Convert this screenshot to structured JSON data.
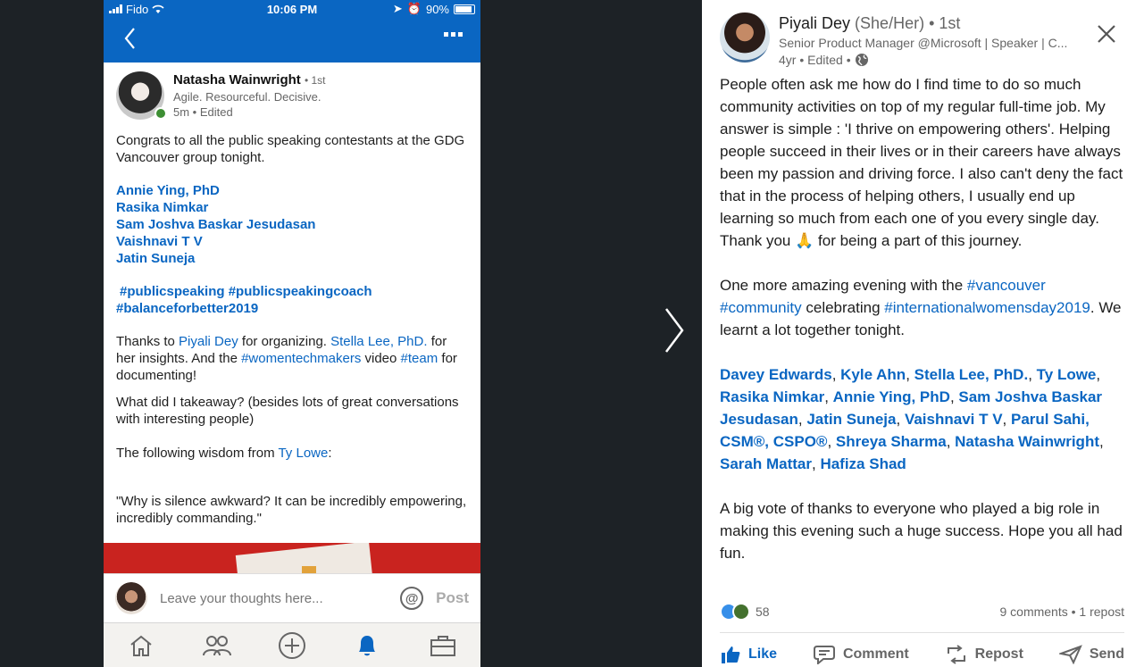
{
  "status_bar": {
    "carrier": "Fido",
    "time": "10:06 PM",
    "battery": "90%"
  },
  "left_post": {
    "author": {
      "name": "Natasha Wainwright",
      "degree": "• 1st",
      "headline": "Agile. Resourceful. Decisive.",
      "meta": "5m • Edited"
    },
    "intro": "Congrats to all the public speaking contestants at the GDG Vancouver group tonight.",
    "names": [
      "Annie Ying, PhD",
      "Rasika Nimkar",
      "Sam Joshva Baskar Jesudasan",
      "Vaishnavi T V",
      "Jatin Suneja"
    ],
    "hashtags_line1": "#publicspeaking #publicspeakingcoach",
    "hashtags_line2": "#balanceforbetter2019",
    "thanks": {
      "t1": "Thanks to ",
      "l1": "Piyali Dey",
      "t2": " for organizing. ",
      "l2": "Stella Lee, PhD.",
      "t3": " for her insights. And the ",
      "l3": "#womentechmakers",
      "t4": " video ",
      "l4": "#team",
      "t5": " for documenting!"
    },
    "takeaway": "What did I takeaway? (besides lots of great conversations with interesting people)",
    "wisdom": {
      "t1": "The following wisdom from ",
      "l1": "Ty Lowe",
      "t2": ":"
    },
    "quote": "\"Why is silence awkward? It can be incredibly empowering, incredibly commanding.\""
  },
  "comment": {
    "placeholder": "Leave your thoughts here...",
    "post_label": "Post"
  },
  "tabs": [
    "home-icon",
    "network-icon",
    "post-icon",
    "notifications-icon",
    "jobs-icon"
  ],
  "right_post": {
    "author": {
      "name": "Piyali Dey",
      "pronouns": "(She/Her)",
      "degree": "• 1st",
      "headline": "Senior Product Manager @Microsoft | Speaker | C...",
      "meta": "4yr • Edited •"
    },
    "p1": "People often ask me how do I find time to do so much community activities on top of my regular full-time job. My answer is simple : 'I thrive on empowering others'. Helping people succeed in their lives or in their careers have always been my passion and driving force. I also can't deny the fact that in the process of helping others, I usually end up learning so much from each one of you every single day. Thank you",
    "p1_emoji": "🙏",
    "p1_end": " for being a part of this journey.",
    "p2": {
      "t1": "One more amazing evening with the ",
      "tag1": "#vancouver",
      "t2": " ",
      "tag2": "#community",
      "t3": " celebrating ",
      "tag3": "#internationalwomensday2019",
      "t4": ". We learnt a lot together tonight."
    },
    "mentions": [
      "Davey Edwards",
      "Kyle Ahn",
      "Stella Lee, PhD.",
      "Ty Lowe",
      "Rasika Nimkar",
      "Annie Ying, PhD",
      "Sam Joshva Baskar Jesudasan",
      "Jatin Suneja",
      "Vaishnavi T V",
      "Parul Sahi, CSM®, CSPO®",
      "Shreya Sharma",
      "Natasha Wainwright",
      "Sarah Mattar",
      "Hafiza Shad"
    ],
    "p3": "A big vote of thanks to everyone who played a big role in making this evening such a huge success. Hope you all had fun.",
    "reactions_count": "58",
    "comments_reposts": "9 comments • 1 repost",
    "actions": {
      "like": "Like",
      "comment": "Comment",
      "repost": "Repost",
      "send": "Send"
    }
  },
  "colors": {
    "linkedin_blue": "#0a66c2",
    "dark_bg": "#1d2226",
    "online_green": "#3d8e33"
  }
}
